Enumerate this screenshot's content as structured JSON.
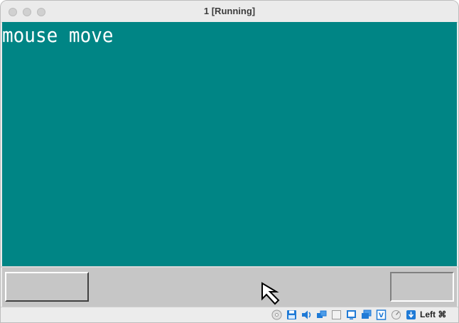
{
  "window": {
    "title": "1 [Running]"
  },
  "guest": {
    "text": "mouse move",
    "background": "#008585"
  },
  "statusbar": {
    "icons": [
      "optical-drive-icon",
      "floppy-icon",
      "audio-icon",
      "network-icon",
      "usb-icon",
      "shared-folders-icon",
      "display-icon",
      "video-capture-icon",
      "cpu-icon",
      "mouse-integration-icon",
      "keyboard-capture-icon"
    ],
    "host_key": "Left ⌘"
  }
}
